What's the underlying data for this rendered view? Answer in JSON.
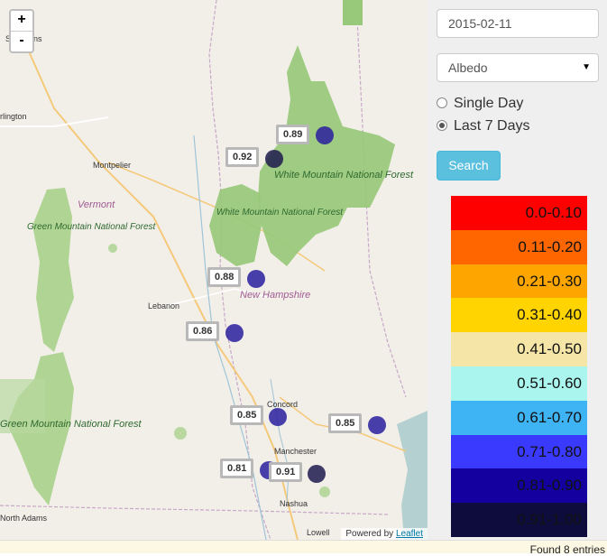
{
  "map": {
    "zoom_in": "+",
    "zoom_out": "-",
    "attribution_text": "Powered by",
    "attribution_link": "Leaflet",
    "places": {
      "st_albans": "St. Albans",
      "burlington": "rlington",
      "montpelier": "Montpelier",
      "vermont": "Vermont",
      "lebanon": "Lebanon",
      "new_hampshire": "New Hampshire",
      "concord": "Concord",
      "manchester": "Manchester",
      "nashua": "Nashua",
      "lowell": "Lowell",
      "north_adams": "North Adams",
      "gmnf_north": "Green Mountain National Forest",
      "gmnf_south": "Green Mountain National Forest",
      "wmnf_east": "White Mountain National Forest",
      "wmnf_west": "White Mountain National Forest"
    },
    "stations": [
      {
        "label": "0.89",
        "color": "#2a1f9e"
      },
      {
        "label": "0.92",
        "color": "#1e1a4f"
      },
      {
        "label": "0.88",
        "color": "#2a1f9e"
      },
      {
        "label": "0.86",
        "color": "#2a1f9e"
      },
      {
        "label": "0.85",
        "color": "#2a1f9e"
      },
      {
        "label": "0.85",
        "color": "#2a1f9e"
      },
      {
        "label": "0.81",
        "color": "#2a1f9e"
      },
      {
        "label": "0.91",
        "color": "#1e1a4f"
      }
    ]
  },
  "sidebar": {
    "date_value": "2015-02-11",
    "variable_selected": "Albedo",
    "radio_single": "Single Day",
    "radio_week": "Last 7 Days",
    "radio_selected": "week",
    "search_label": "Search",
    "legend": [
      {
        "range": "0.0-0.10",
        "color": "#ff0000"
      },
      {
        "range": "0.11-0.20",
        "color": "#ff6600"
      },
      {
        "range": "0.21-0.30",
        "color": "#ffa500"
      },
      {
        "range": "0.31-0.40",
        "color": "#ffd400"
      },
      {
        "range": "0.41-0.50",
        "color": "#f5e6a8"
      },
      {
        "range": "0.51-0.60",
        "color": "#aaf5ee"
      },
      {
        "range": "0.61-0.70",
        "color": "#3fb4f5"
      },
      {
        "range": "0.71-0.80",
        "color": "#3a3aff"
      },
      {
        "range": "0.81-0.90",
        "color": "#13009e"
      },
      {
        "range": "0.91-1.00",
        "color": "#0e0b3d"
      }
    ]
  },
  "footer": {
    "text": "Found 8 entries"
  }
}
